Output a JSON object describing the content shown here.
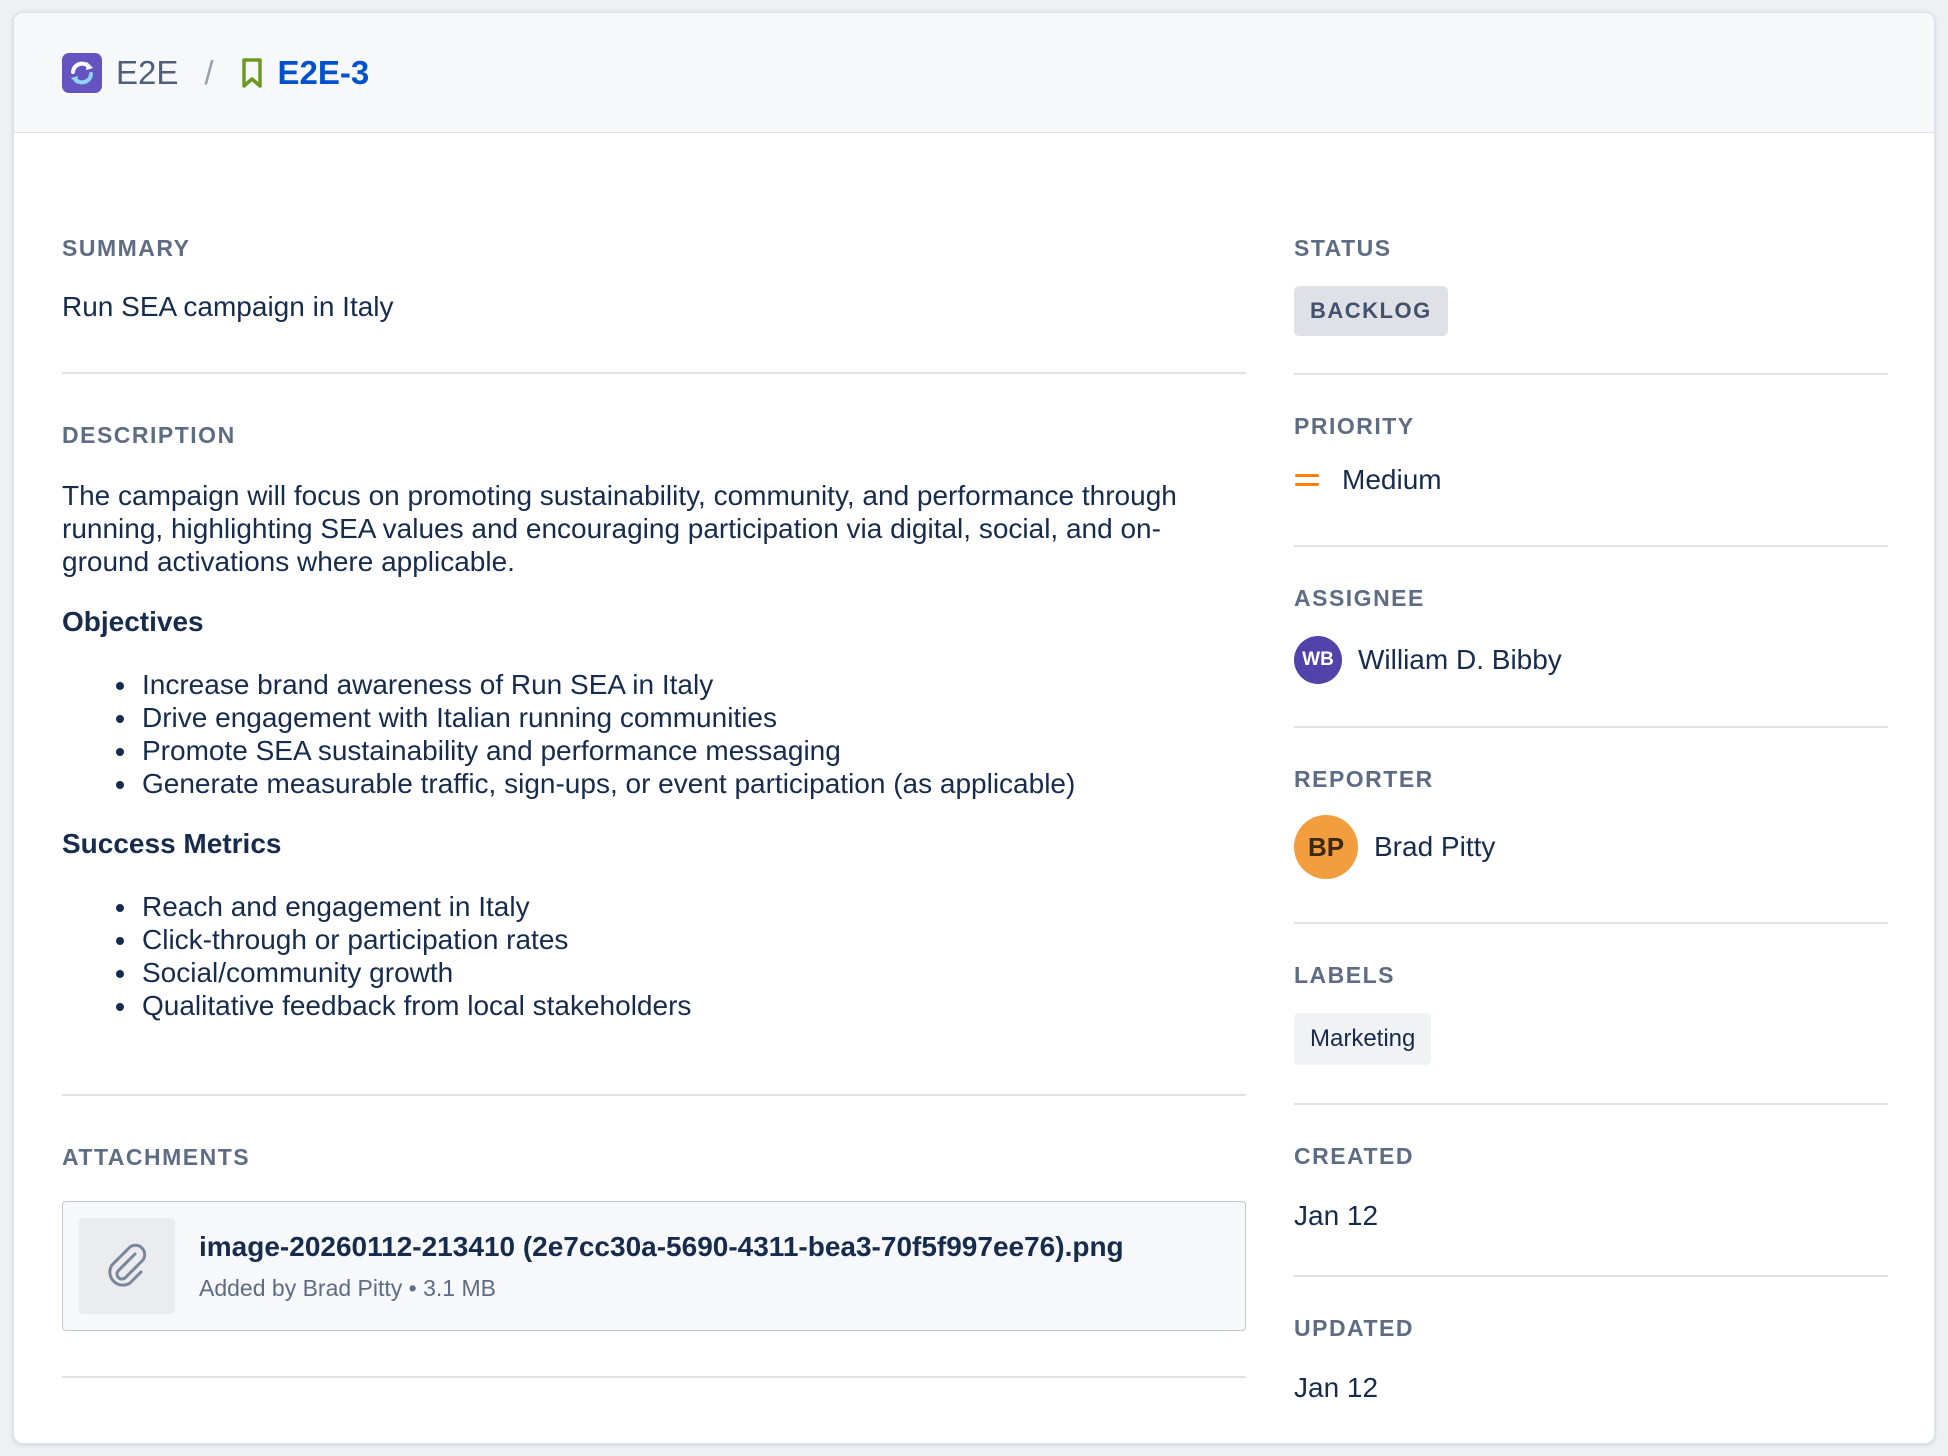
{
  "header": {
    "project_key": "E2E",
    "separator": "/",
    "issue_key": "E2E-3"
  },
  "summary": {
    "label": "Summary",
    "text": "Run SEA campaign in Italy"
  },
  "description": {
    "label": "Description",
    "intro": "The campaign will focus on promoting sustainability, community, and performance through running, highlighting SEA values and encouraging participation via digital, social, and on-ground activations where applicable.",
    "objectives_heading": "Objectives",
    "objectives": [
      "Increase brand awareness of Run SEA in Italy",
      "Drive engagement with Italian running communities",
      "Promote SEA sustainability and performance messaging",
      "Generate measurable traffic, sign-ups, or event participation (as applicable)"
    ],
    "metrics_heading": "Success Metrics",
    "metrics": [
      "Reach and engagement in Italy",
      "Click-through or participation rates",
      "Social/community growth",
      "Qualitative feedback from local stakeholders"
    ]
  },
  "attachments": {
    "label": "Attachments",
    "items": [
      {
        "filename": "image-20260112-213410 (2e7cc30a-5690-4311-bea3-70f5f997ee76).png",
        "meta": "Added by Brad Pitty • 3.1 MB"
      }
    ]
  },
  "sidebar": {
    "status": {
      "label": "Status",
      "value": "BACKLOG"
    },
    "priority": {
      "label": "Priority",
      "value": "Medium",
      "color": "#ff7f00"
    },
    "assignee": {
      "label": "Assignee",
      "initials": "WB",
      "name": "William D. Bibby",
      "color": "#5243aa"
    },
    "reporter": {
      "label": "Reporter",
      "initials": "BP",
      "name": "Brad Pitty",
      "color": "#f29d3e"
    },
    "labels": {
      "label": "Labels",
      "value": "Marketing"
    },
    "created": {
      "label": "Created",
      "value": "Jan 12"
    },
    "updated": {
      "label": "Updated",
      "value": "Jan 12"
    }
  },
  "icons": {
    "project": "project-sync-icon",
    "issue_type": "bookmark-icon",
    "priority": "priority-medium-icon",
    "attachment": "paperclip-icon"
  },
  "colors": {
    "project_icon": "#6554c0",
    "issue_key": "#0052cc",
    "bookmark": "#6a9a23"
  }
}
